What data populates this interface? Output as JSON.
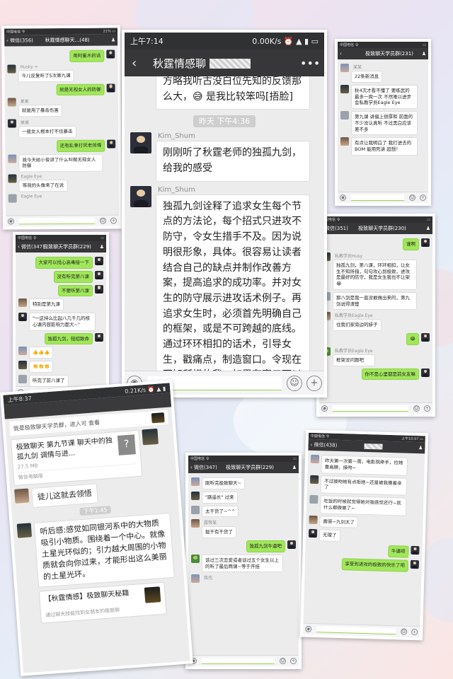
{
  "c1": {
    "status": {
      "left": "中国电信 令",
      "right": "21% ▭"
    },
    "back": "‹ 微信(356)",
    "title": "秋霆情感聊天...(48)",
    "messages": [
      {
        "dir": "right",
        "text": "用阿量木的话"
      },
      {
        "dir": "left",
        "name": "Husky ≈",
        "text": "今儿反复听了5次第九课"
      },
      {
        "dir": "right",
        "text": "就是无视女人的防御"
      },
      {
        "dir": "left",
        "name": "某某",
        "text": "就是用了暴击伤害"
      },
      {
        "dir": "left",
        "name": "某某",
        "text": "一般女人根本打不住暴击"
      },
      {
        "dir": "right",
        "text": "还有乱拳打死老师傅"
      },
      {
        "dir": "left",
        "name": "",
        "text": "我今天给小俊讲了什么叫做无视女人防御"
      },
      {
        "dir": "left",
        "name": "Eagle Eye",
        "text": "等我的头像来了在说"
      },
      {
        "dir": "left",
        "name": "Eagle Eye",
        "text": ""
      }
    ]
  },
  "c2": {
    "status": {
      "time": "上午7:14",
      "right": "0.00K/s ⏰ ▲ ▮ ▭"
    },
    "back": "‹",
    "title": "秋霆情感聊",
    "top_text": "方略我听古没白位先知的反馈那么大，😅 是我比较笨吗[捂脸]",
    "time": "昨天 下午4:36",
    "sender": "Kim_Shum",
    "msg1": "刚刚听了秋霆老师的独孤九剑，给我的感受",
    "msg2": "独孤九剑诠释了追求女生每个节点的方法论，每个招式只进攻不防守，令女生措手不及。因为说明很形象，具体。很容易让读者结合自己的缺点并制作改善方案，提高追求的成功率。并对女生的防守展示进攻话术例子。再追求女生时，必须首先明确自己的框架，或是不可跨越的底线。通过环环相扣的话术，引导女生，戳痛点，制造窗口。令现在不知所措的我，如果有窗口可以聊到情感层次，知道我应该怎么做。"
  },
  "c3": {
    "status": {
      "left": "中国电信 令",
      "right": "▭"
    },
    "back": "‹",
    "title": "极致聊天学员群(231)",
    "messages": [
      {
        "dir": "left",
        "name": "某某",
        "text": "22条新消息"
      },
      {
        "dir": "left",
        "name": "",
        "text": "秋4次才看不懂了 要练武的最多一周一次 不然难以进步会私教学员Eagle Eye"
      },
      {
        "dir": "left",
        "name": "",
        "text": "第九课 讲偏上很厚和 前面的不少没认真听 不过黑白应该差不多"
      },
      {
        "dir": "left",
        "name": "",
        "text": "有点让我明白了 我打进去的BOM 能用死讲 超想！"
      }
    ]
  },
  "c4": {
    "status": {
      "left": "中国电信 令",
      "right": "▭"
    },
    "back": "‹ 微信(347)",
    "title": "极致聊天学员群(229)",
    "messages": [
      {
        "dir": "right",
        "text": "大家可以找心高毒接一下"
      },
      {
        "dir": "right",
        "text": "没有听完第八课"
      },
      {
        "dir": "right",
        "text": "不要听第八课"
      },
      {
        "dir": "left",
        "name": "",
        "text": "特别是第九课"
      },
      {
        "dir": "left",
        "name": "",
        "text": "\"一这持么比起八几千几的核心课内容影响力都大~\""
      },
      {
        "dir": "right",
        "text": "独孤九剑，轻招致命"
      },
      {
        "dir": "left",
        "name": "",
        "text": "👍👍👍"
      },
      {
        "dir": "left",
        "name": "",
        "text": "👏👏👏"
      },
      {
        "dir": "left",
        "name": "",
        "text": "听完了前八课了"
      }
    ]
  },
  "c5": {
    "status": {
      "left": "中国电信 令",
      "right": "▭"
    },
    "back": "‹ 微信(351)",
    "title": "极致聊天学员群(230)",
    "messages": [
      {
        "dir": "right",
        "text": "谨啊"
      },
      {
        "dir": "left",
        "name": "私教学员Husy",
        "text": "独孤九剑，第八课，环环相扣，让女生不知所措，句句攻心到极致，进攻是最好的防守，我是女生我也不让架😭"
      },
      {
        "dir": "left",
        "name": "",
        "text": "那八剑是我一直没敢做出来的，第九剑说得清楚"
      },
      {
        "dir": "left",
        "name": "私教学员Eagle Eye",
        "text": "住我们家旁边的妹子"
      },
      {
        "dir": "right",
        "text": "😂"
      },
      {
        "dir": "left",
        "name": "私教学员Eagle Eye",
        "text": "框架没问题吧"
      },
      {
        "dir": "right",
        "text": "你不是心里都是前女友嘛"
      }
    ]
  },
  "c6": {
    "status": {
      "left": "上午8:37",
      "right": "0.21K/s ⏰ ▲ ▮"
    },
    "banner": "我是极致聊天学员群，进入可 查看",
    "file_title": "极致聊天 第九节课 聊天中的独孤九剑 调情与进...",
    "file_icon": "?",
    "file_size": "27.5 MB",
    "file_src": "微信电脑版",
    "msg1": "徒儿这就去领悟",
    "time": "下午1:45",
    "msg2": "听后感:感觉如同银河系中的大物质吸引小物质。围绕着一个中心。就像土星光环似的；引力越大周围的小物质就会向你过来，才能形出这么美丽的土星光环。",
    "msg3": "【秋霆情感】极致聊天秘籍",
    "msg3_sub": "通过聊天技能找到女朋友的极致聊"
  },
  "c7": {
    "status": {
      "left": "中国电信 令",
      "right": "▭"
    },
    "back": "‹ 微信(347)",
    "title": "极致聊天学员群(229)",
    "messages": [
      {
        "dir": "left",
        "name": "",
        "text": "刚听完极致聊天~"
      },
      {
        "dir": "left",
        "name": "",
        "text": "\"路遥长\" 过来"
      },
      {
        "dir": "left",
        "name": "",
        "text": "太干货了~^^"
      },
      {
        "dir": "left",
        "name": "露等某",
        "text": "挺干有干货了"
      },
      {
        "dir": "right",
        "text": "独孤九剑牛逼吧"
      },
      {
        "dir": "left",
        "name": "",
        "text": "该过三次恋爱或者谈过五个女生以上的听了最后两课~等于开挂"
      },
      {
        "dir": "left",
        "name": "我也",
        "text": ""
      }
    ]
  },
  "c8": {
    "status": {
      "left": "中国电信 令",
      "right": "上午10:07 ▭"
    },
    "back": "‹ 微信(438)",
    "title": "",
    "messages": [
      {
        "dir": "left",
        "name": "",
        "text": "昨天第一次第一周，电影院牵手，拉她靠肩膀，接吻~"
      },
      {
        "dir": "left",
        "name": "",
        "text": "不过接吻她有点拒绝~还是被我摸着亲了"
      },
      {
        "dir": "left",
        "name": "",
        "text": "吃饭的时候就觉得她对我感觉还行~就什么都做做了~"
      },
      {
        "dir": "left",
        "name": "",
        "text": "霞哥~九剑太了"
      },
      {
        "dir": "left",
        "name": "",
        "text": "无理了"
      },
      {
        "dir": "right",
        "text": "牛逼吧"
      },
      {
        "dir": "right",
        "text": "享受到进攻的极致的快乐了吧"
      }
    ]
  },
  "colors": {
    "green_bubble": "#a0e75a",
    "navbar": "#373739",
    "chat_bg": "#ececec"
  }
}
